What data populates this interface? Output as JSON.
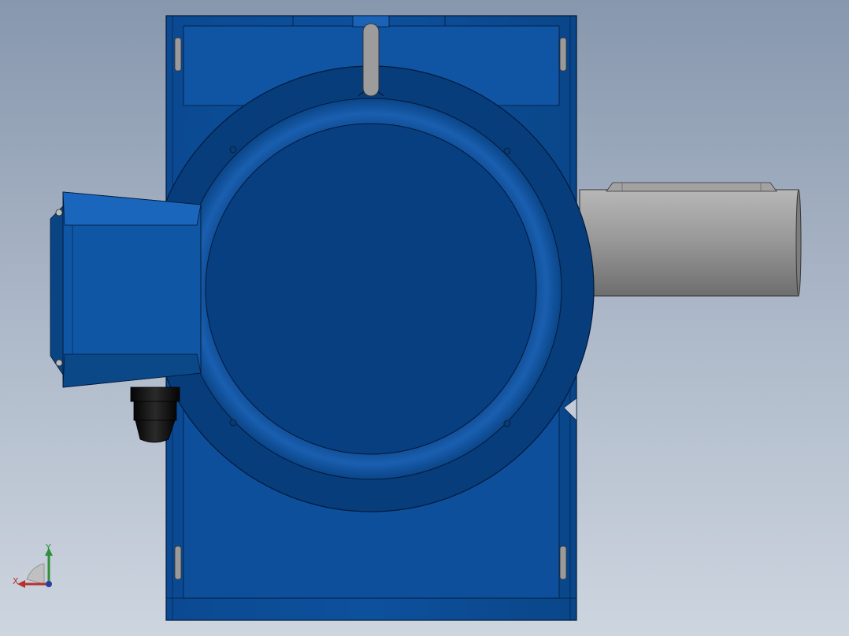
{
  "viewport": {
    "background_top": "#8797ad",
    "background_bottom": "#cdd5df"
  },
  "model": {
    "body_color": "#0c4d96",
    "body_dark": "#073a78",
    "shaft_color": "#8f8f8f",
    "gland_color": "#151515"
  },
  "triad": {
    "x_label": "X",
    "y_label": "Y",
    "x_color": "#b8312e",
    "y_color": "#2f8f3a",
    "z_color": "#2a3f9e"
  }
}
